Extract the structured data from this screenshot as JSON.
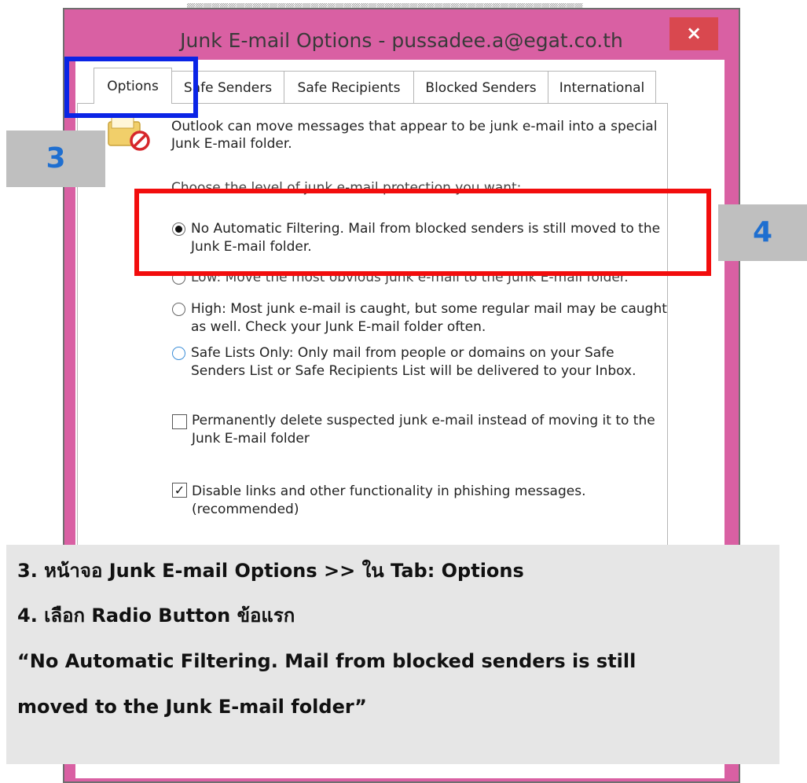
{
  "window": {
    "title": "Junk E-mail Options - pussadee.a@egat.co.th",
    "close_glyph": "×"
  },
  "tabs": [
    {
      "label": "Options",
      "active": true
    },
    {
      "label": "Safe Senders",
      "active": false
    },
    {
      "label": "Safe Recipients",
      "active": false
    },
    {
      "label": "Blocked Senders",
      "active": false
    },
    {
      "label": "International",
      "active": false
    }
  ],
  "options": {
    "intro_line1": "Outlook can move messages that appear to be junk e-mail into a special",
    "intro_line2": "Junk E-mail folder.",
    "level_prompt": "Choose the level of junk e-mail protection you want:",
    "radios": [
      {
        "line1": "No Automatic Filtering. Mail from blocked senders is still moved to the",
        "line2": "Junk E-mail folder.",
        "checked": true
      },
      {
        "line1": "Low: Move the most obvious junk e-mail to the Junk E-mail folder.",
        "line2": "",
        "checked": false
      },
      {
        "line1": "High: Most junk e-mail is caught, but some regular mail may be caught",
        "line2": "as well. Check your Junk E-mail folder often.",
        "checked": false
      },
      {
        "line1": "Safe Lists Only: Only mail from people or domains on your Safe",
        "line2": "Senders List or Safe Recipients List will be delivered to your Inbox.",
        "checked": false
      }
    ],
    "checkboxes": [
      {
        "line1": "Permanently delete suspected junk e-mail instead of moving it to the",
        "line2": "Junk E-mail folder",
        "checked": false
      },
      {
        "line1": "Disable links and other functionality in phishing messages.",
        "line2": "(recommended)",
        "checked": true
      }
    ]
  },
  "annotations": {
    "step3_badge": "3",
    "step4_badge": "4",
    "highlight_tab_color": "#0a24e6",
    "highlight_radio_color": "#f20d0d"
  },
  "instructions": {
    "line1": "3. หน้าจอ Junk E-mail Options >> ใน Tab: Options",
    "line2": "4. เลือก Radio Button ข้อแรก",
    "line3": "“No Automatic Filtering. Mail from blocked senders is still",
    "line4": "moved to the Junk E-mail folder”"
  },
  "colors": {
    "window_frame": "#d960a3",
    "close_button": "#d9484f",
    "badge_bg": "#bfbfbf",
    "badge_text": "#1f6fd0",
    "instructions_bg": "#e6e6e6"
  }
}
